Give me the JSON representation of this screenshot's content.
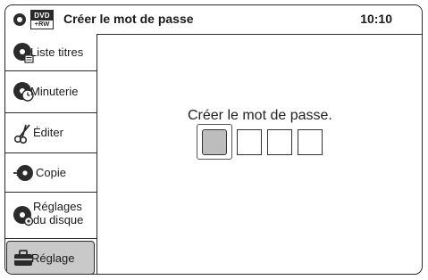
{
  "header": {
    "media_badge_top": "DVD",
    "media_badge_bottom": "+RW",
    "title": "Créer le mot de passe",
    "time": "10:10"
  },
  "sidebar": {
    "items": [
      {
        "label_line1": "Liste titres",
        "label_line2": "",
        "icon": "title-list-icon",
        "selected": false
      },
      {
        "label_line1": "Minuterie",
        "label_line2": "",
        "icon": "timer-icon",
        "selected": false
      },
      {
        "label_line1": "Éditer",
        "label_line2": "",
        "icon": "scissors-icon",
        "selected": false
      },
      {
        "label_line1": "Copie",
        "label_line2": "",
        "icon": "copy-icon",
        "selected": false
      },
      {
        "label_line1": "Réglages",
        "label_line2": "du disque",
        "icon": "disc-settings-icon",
        "selected": false
      },
      {
        "label_line1": "Réglage",
        "label_line2": "",
        "icon": "toolbox-icon",
        "selected": true
      }
    ]
  },
  "main": {
    "prompt": "Créer le mot de passe.",
    "password_boxes": 4,
    "active_box_index": 0
  }
}
